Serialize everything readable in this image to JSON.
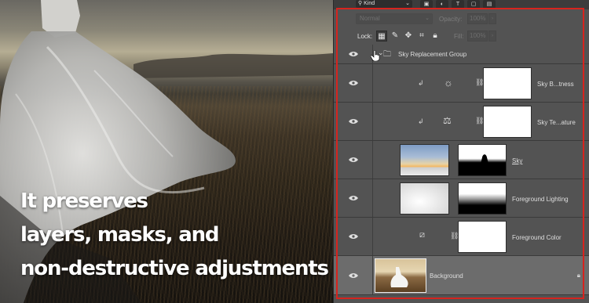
{
  "photo": {
    "caption_lines": [
      "It preserves",
      "layers, masks, and",
      "non-destructive adjustments"
    ]
  },
  "panel": {
    "filter": {
      "kind_label": "Kind"
    },
    "blend": {
      "mode": "Normal",
      "opacity_label": "Opacity:",
      "opacity_value": "100%"
    },
    "lock": {
      "label": "Lock:",
      "fill_label": "Fill:",
      "fill_value": "100%"
    },
    "layers": [
      {
        "name": "Sky Replacement Group",
        "type": "group"
      },
      {
        "name": "Sky B...tness",
        "type": "adjustment",
        "icon": "brightness-icon"
      },
      {
        "name": "Sky Te...ature",
        "type": "adjustment",
        "icon": "balance-icon"
      },
      {
        "name": "Sky",
        "type": "pixel"
      },
      {
        "name": "Foreground Lighting",
        "type": "pixel"
      },
      {
        "name": "Foreground Color",
        "type": "fill"
      },
      {
        "name": "Background",
        "type": "background"
      }
    ]
  },
  "colors": {
    "highlight_frame": "#d6241e",
    "panel_bg": "#535353"
  }
}
